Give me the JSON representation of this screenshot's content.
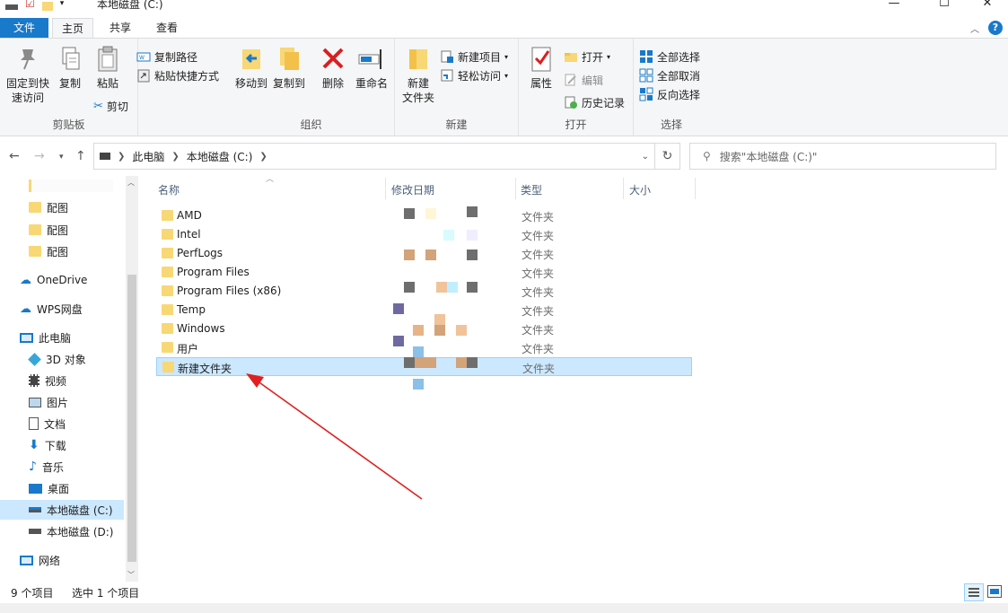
{
  "window": {
    "title": "本地磁盘 (C:)",
    "min_glyph": "—",
    "max_glyph": "☐",
    "close_glyph": "✕"
  },
  "ribbon_tabs": {
    "file": "文件",
    "home": "主页",
    "share": "共享",
    "view": "查看"
  },
  "ribbon": {
    "clipboard": {
      "label": "剪贴板",
      "pin_line1": "固定到快",
      "pin_line2": "速访问",
      "copy": "复制",
      "paste": "粘贴",
      "copy_path": "复制路径",
      "paste_shortcut": "粘贴快捷方式",
      "cut": "剪切"
    },
    "organize": {
      "label": "组织",
      "move_to": "移动到",
      "copy_to": "复制到",
      "delete": "删除",
      "rename": "重命名"
    },
    "new": {
      "label": "新建",
      "new_folder_line1": "新建",
      "new_folder_line2": "文件夹",
      "new_item": "新建项目",
      "easy_access": "轻松访问"
    },
    "open": {
      "label": "打开",
      "properties": "属性",
      "open": "打开",
      "edit": "编辑",
      "history": "历史记录"
    },
    "select": {
      "label": "选择",
      "select_all": "全部选择",
      "select_none": "全部取消",
      "invert": "反向选择"
    }
  },
  "address": {
    "segments": [
      "此电脑",
      "本地磁盘 (C:)"
    ],
    "search_placeholder": "搜索\"本地磁盘 (C:)\""
  },
  "nav_pane": {
    "items": [
      {
        "label": "配图"
      },
      {
        "label": "配图"
      },
      {
        "label": "配图"
      },
      {
        "label": "OneDrive"
      },
      {
        "label": "WPS网盘"
      },
      {
        "label": "此电脑"
      },
      {
        "label": "3D 对象"
      },
      {
        "label": "视频"
      },
      {
        "label": "图片"
      },
      {
        "label": "文档"
      },
      {
        "label": "下载"
      },
      {
        "label": "音乐"
      },
      {
        "label": "桌面"
      },
      {
        "label": "本地磁盘 (C:)"
      },
      {
        "label": "本地磁盘 (D:)"
      },
      {
        "label": "网络"
      }
    ]
  },
  "file_list": {
    "columns": {
      "name": "名称",
      "date": "修改日期",
      "type": "类型",
      "size": "大小"
    },
    "rows": [
      {
        "name": "AMD",
        "type": "文件夹"
      },
      {
        "name": "Intel",
        "type": "文件夹"
      },
      {
        "name": "PerfLogs",
        "type": "文件夹"
      },
      {
        "name": "Program Files",
        "type": "文件夹"
      },
      {
        "name": "Program Files (x86)",
        "type": "文件夹"
      },
      {
        "name": "Temp",
        "type": "文件夹"
      },
      {
        "name": "Windows",
        "type": "文件夹"
      },
      {
        "name": "用户",
        "type": "文件夹"
      },
      {
        "name": "新建文件夹",
        "type": "文件夹",
        "selected": true
      }
    ]
  },
  "status": {
    "item_count": "9 个项目",
    "selection": "选中 1 个项目"
  },
  "colors": {
    "accent": "#1979ca",
    "selection": "#cce8ff",
    "folder": "#f8d775",
    "annotation_arrow": "#e02020"
  }
}
